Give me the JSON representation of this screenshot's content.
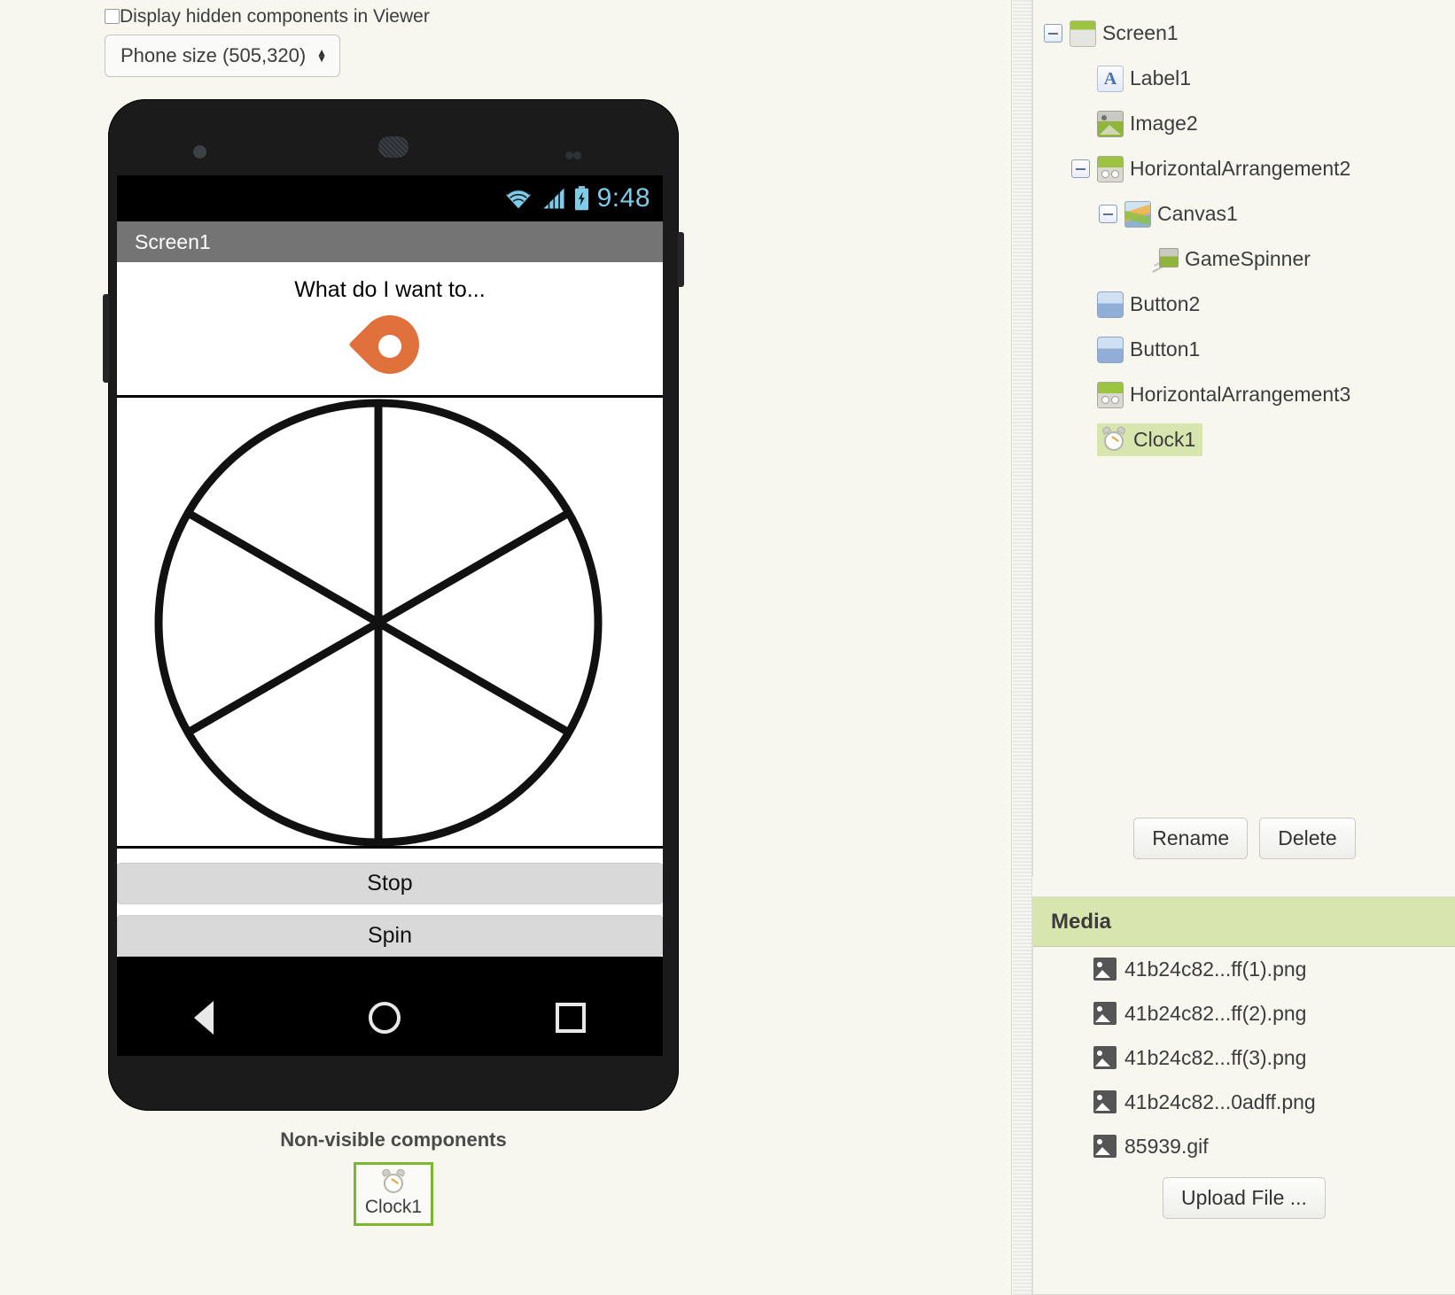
{
  "viewer": {
    "display_hidden_label": "Display hidden components in Viewer",
    "phone_size_value": "Phone size (505,320)",
    "nonvisible_title": "Non-visible components",
    "nonvisible_items": [
      {
        "name": "Clock1",
        "icon": "clock-icon"
      }
    ]
  },
  "phone": {
    "status_time": "9:48",
    "title_bar": "Screen1",
    "label1_text": "What do I want to...",
    "image2_icon": "map-pin-icon",
    "canvas": {
      "shape": "six-slice-circle",
      "slices": 6,
      "stroke_color": "#111111",
      "background": "#ffffff"
    },
    "buttons": [
      {
        "name": "Button2",
        "label": "Stop"
      },
      {
        "name": "Button1",
        "label": "Spin"
      }
    ],
    "nav": {
      "back": "back-icon",
      "home": "home-icon",
      "recents": "recents-icon"
    }
  },
  "components": {
    "tree": [
      {
        "label": "Screen1",
        "icon": "screen-icon",
        "indent": 0,
        "toggle": "minus",
        "selected": false
      },
      {
        "label": "Label1",
        "icon": "label-icon",
        "indent": 1,
        "toggle": "none",
        "selected": false
      },
      {
        "label": "Image2",
        "icon": "image-icon",
        "indent": 1,
        "toggle": "none",
        "selected": false
      },
      {
        "label": "HorizontalArrangement2",
        "icon": "harr-icon",
        "indent": 1,
        "toggle": "minus",
        "selected": false
      },
      {
        "label": "Canvas1",
        "icon": "canvas-icon",
        "indent": 2,
        "toggle": "minus",
        "selected": false
      },
      {
        "label": "GameSpinner",
        "icon": "sprite-icon",
        "indent": 3,
        "toggle": "none",
        "selected": false
      },
      {
        "label": "Button2",
        "icon": "button-icon",
        "indent": 1,
        "toggle": "none",
        "selected": false
      },
      {
        "label": "Button1",
        "icon": "button-icon",
        "indent": 1,
        "toggle": "none",
        "selected": false
      },
      {
        "label": "HorizontalArrangement3",
        "icon": "harr-icon",
        "indent": 1,
        "toggle": "none",
        "selected": false
      },
      {
        "label": "Clock1",
        "icon": "clock-icon",
        "indent": 1,
        "toggle": "none",
        "selected": true
      }
    ],
    "rename_label": "Rename",
    "delete_label": "Delete"
  },
  "media": {
    "header": "Media",
    "files": [
      "41b24c82...ff(1).png",
      "41b24c82...ff(2).png",
      "41b24c82...ff(3).png",
      "41b24c82...0adff.png",
      "85939.gif"
    ],
    "upload_label": "Upload File ..."
  },
  "colors": {
    "page_bg": "#f7f7f0",
    "selection_green": "#d7e5ae",
    "nonvisible_border": "#7db72f",
    "pin_orange": "#e0703c",
    "status_icon_blue": "#7fcbe8",
    "titlebar_gray": "#747474"
  }
}
